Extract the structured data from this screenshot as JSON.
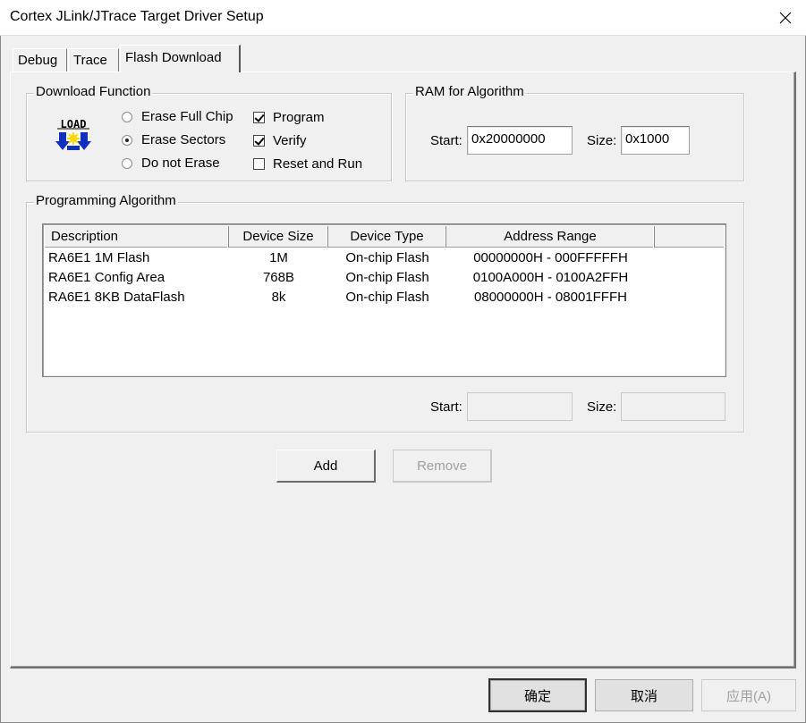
{
  "window": {
    "title": "Cortex JLink/JTrace Target Driver Setup"
  },
  "tabs": [
    {
      "label": "Debug",
      "active": false
    },
    {
      "label": "Trace",
      "active": false
    },
    {
      "label": "Flash Download",
      "active": true
    }
  ],
  "download_function": {
    "legend": "Download Function",
    "icon_label": "LOAD",
    "radios": [
      {
        "label": "Erase Full Chip",
        "checked": false
      },
      {
        "label": "Erase Sectors",
        "checked": true
      },
      {
        "label": "Do not Erase",
        "checked": false
      }
    ],
    "checks": [
      {
        "label": "Program",
        "checked": true
      },
      {
        "label": "Verify",
        "checked": true
      },
      {
        "label": "Reset and Run",
        "checked": false
      }
    ]
  },
  "ram": {
    "legend": "RAM for Algorithm",
    "start_label": "Start:",
    "start_value": "0x20000000",
    "size_label": "Size:",
    "size_value": "0x1000"
  },
  "programming": {
    "legend": "Programming Algorithm",
    "columns": [
      "Description",
      "Device Size",
      "Device Type",
      "Address Range"
    ],
    "rows": [
      [
        "RA6E1 1M Flash",
        "1M",
        "On-chip Flash",
        "00000000H - 000FFFFFH"
      ],
      [
        "RA6E1 Config Area",
        "768B",
        "On-chip Flash",
        "0100A000H - 0100A2FFH"
      ],
      [
        "RA6E1 8KB DataFlash",
        "8k",
        "On-chip Flash",
        "08000000H - 08001FFFH"
      ]
    ],
    "start_label": "Start:",
    "start_value": "",
    "size_label": "Size:",
    "size_value": ""
  },
  "buttons": {
    "add": "Add",
    "remove": "Remove",
    "ok": "确定",
    "cancel": "取消",
    "apply": "应用(A)"
  }
}
